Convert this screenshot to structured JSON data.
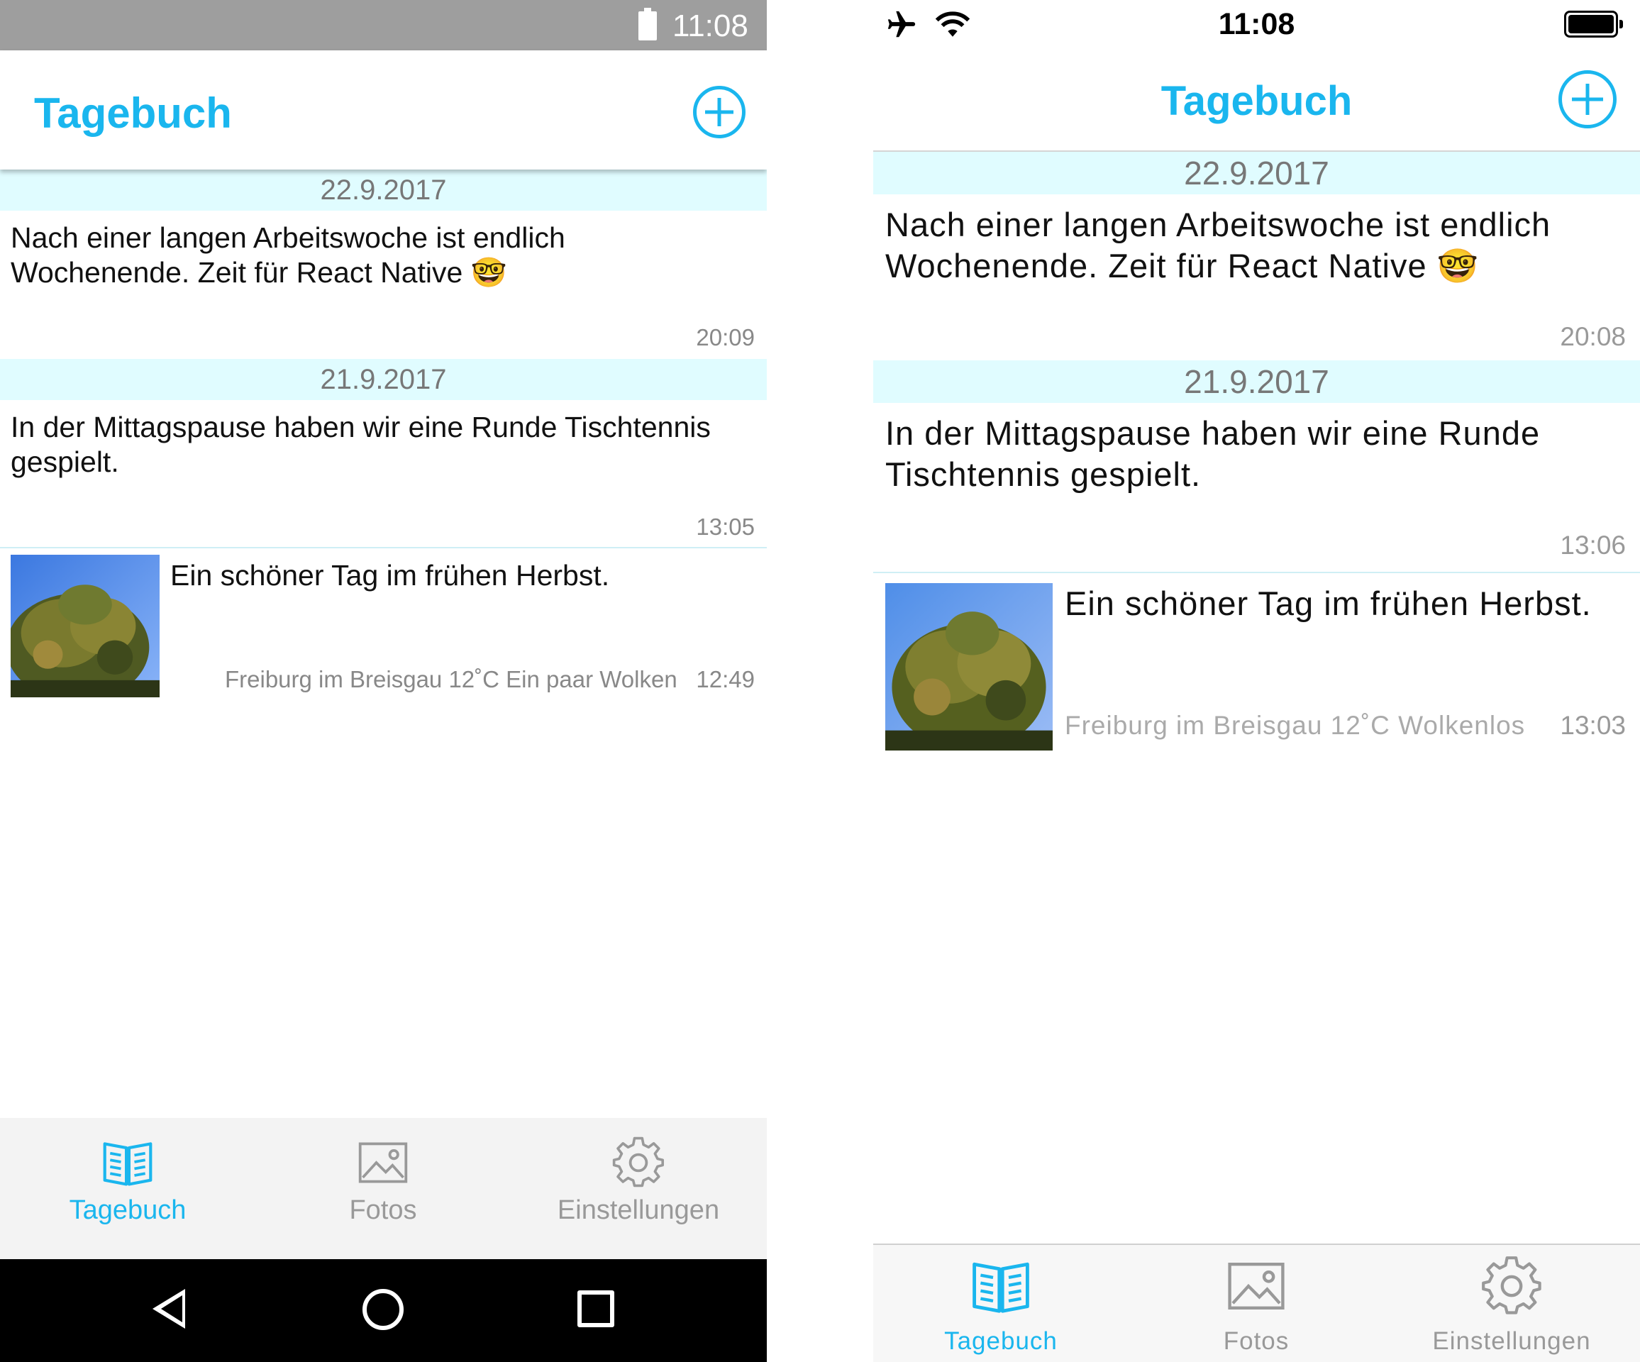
{
  "android": {
    "status_bar": {
      "time": "11:08"
    },
    "header": {
      "title": "Tagebuch"
    },
    "entries": [
      {
        "date": "22.9.2017",
        "text": "Nach einer langen Arbeitswoche ist endlich Wochenende. Zeit für React Native 🤓",
        "time": "20:09"
      },
      {
        "date": "21.9.2017",
        "text": "In der Mittagspause haben wir eine Runde Tischtennis gespielt.",
        "time": "13:05"
      },
      {
        "text": "Ein schöner Tag im frühen Herbst.",
        "meta": "Freiburg im Breisgau  12˚C Ein paar Wolken",
        "time": "12:49"
      }
    ],
    "tabs": [
      {
        "label": "Tagebuch",
        "icon": "book-icon",
        "active": true
      },
      {
        "label": "Fotos",
        "icon": "image-icon",
        "active": false
      },
      {
        "label": "Einstellungen",
        "icon": "gear-icon",
        "active": false
      }
    ],
    "nav_buttons": [
      "back-icon",
      "home-icon",
      "recents-icon"
    ]
  },
  "ios": {
    "status_bar": {
      "time": "11:08",
      "icons": [
        "airplane-icon",
        "wifi-icon",
        "battery-icon"
      ]
    },
    "header": {
      "title": "Tagebuch"
    },
    "entries": [
      {
        "date": "22.9.2017",
        "text": "Nach einer langen Arbeitswoche ist endlich Wochenende. Zeit für React Native 🤓",
        "time": "20:08"
      },
      {
        "date": "21.9.2017",
        "text": "In der Mittagspause haben wir eine Runde Tischtennis gespielt.",
        "time": "13:06"
      },
      {
        "text": "Ein schöner Tag im frühen Herbst.",
        "meta": "Freiburg im Breisgau  12˚C Wolkenlos",
        "time": "13:03"
      }
    ],
    "tabs": [
      {
        "label": "Tagebuch",
        "icon": "book-icon",
        "active": true
      },
      {
        "label": "Fotos",
        "icon": "image-icon",
        "active": false
      },
      {
        "label": "Einstellungen",
        "icon": "gear-icon",
        "active": false
      }
    ]
  },
  "colors": {
    "accent": "#1ab6ee",
    "date_bar": "#e0fcff",
    "android_status": "#9e9e9e",
    "tab_inactive": "#999999"
  }
}
